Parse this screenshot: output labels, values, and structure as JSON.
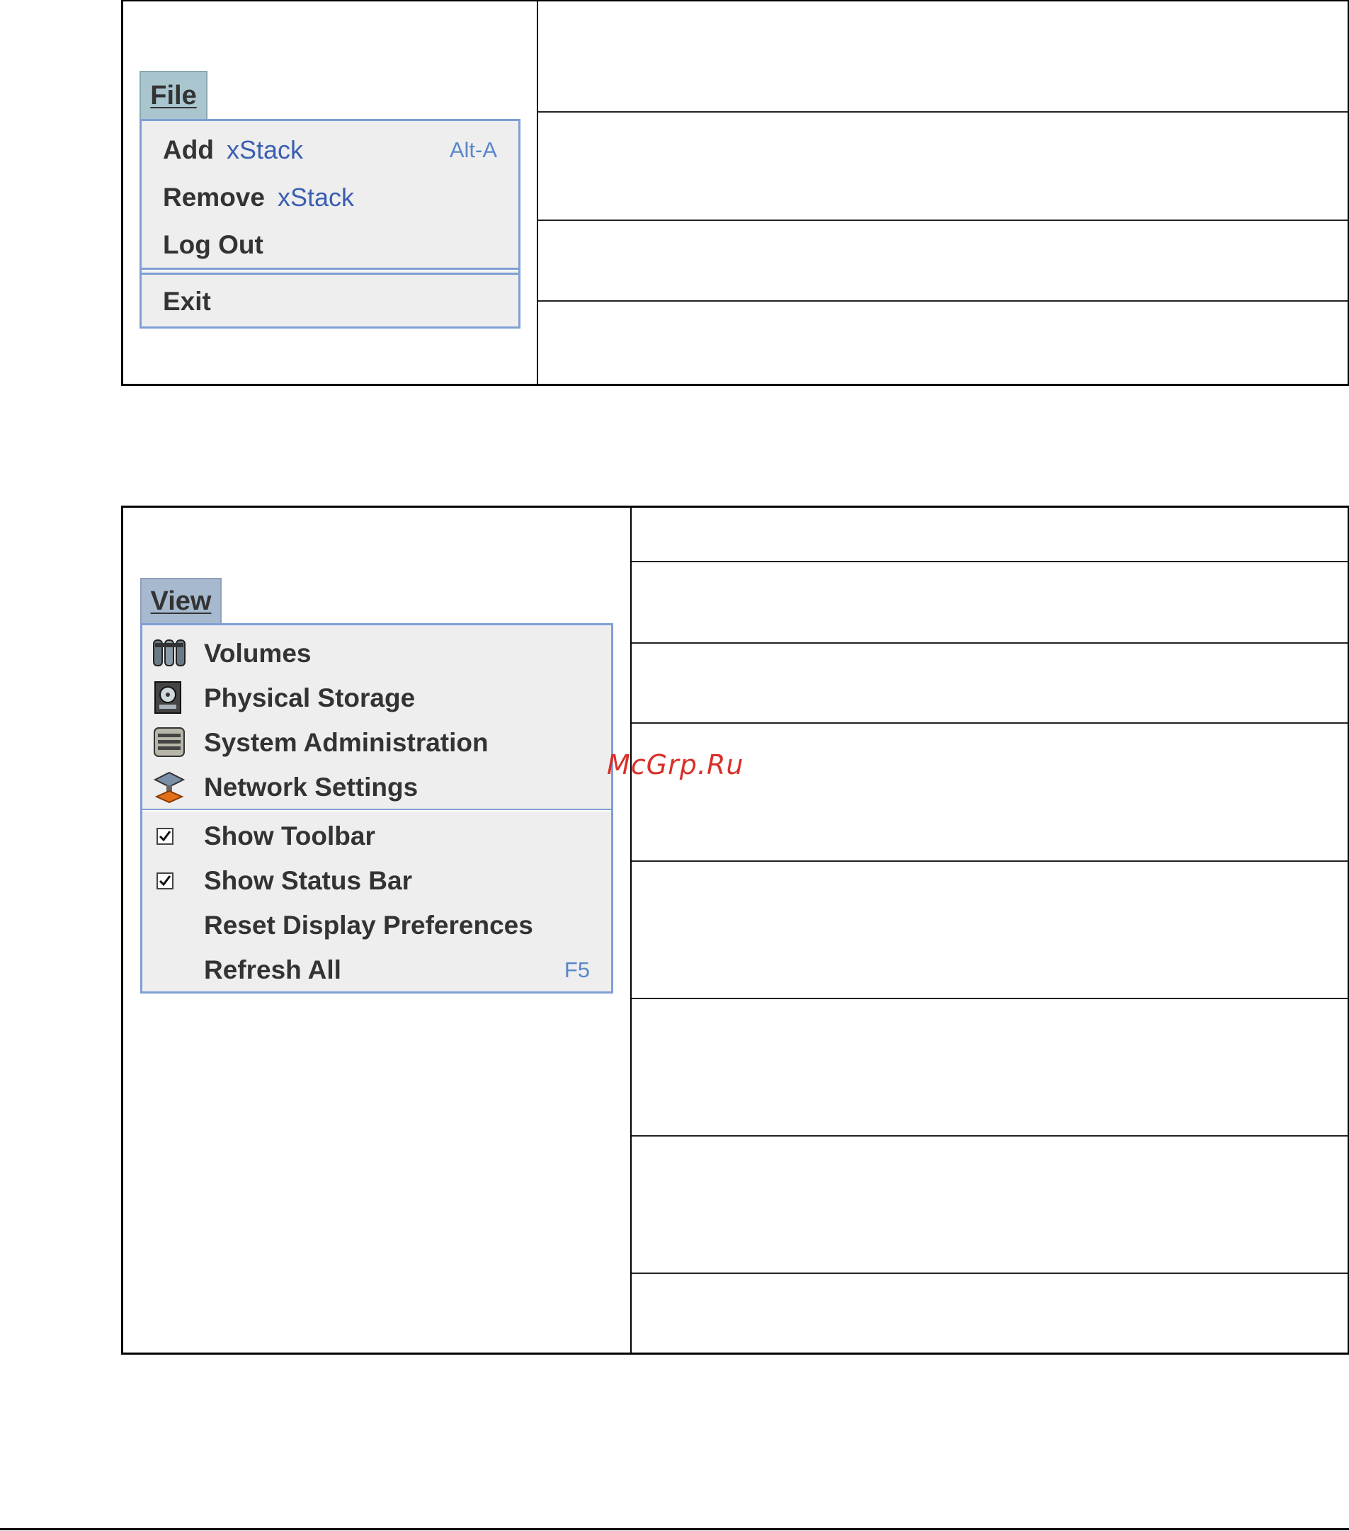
{
  "file_menu": {
    "header": "File",
    "items": [
      {
        "label": "Add",
        "sub": "xStack",
        "accel": "Alt-A"
      },
      {
        "label": "Remove",
        "sub": "xStack",
        "accel": ""
      },
      {
        "label": "Log Out",
        "sub": "",
        "accel": ""
      },
      {
        "label": "Exit",
        "sub": "",
        "accel": ""
      }
    ]
  },
  "view_menu": {
    "header": "View",
    "items": [
      {
        "label": "Volumes",
        "icon": "volumes-icon"
      },
      {
        "label": "Physical Storage",
        "icon": "hard-drive-icon"
      },
      {
        "label": "System Administration",
        "icon": "server-icon"
      },
      {
        "label": "Network Settings",
        "icon": "network-icon"
      },
      {
        "label": "Show Toolbar",
        "checked": true
      },
      {
        "label": "Show Status Bar",
        "checked": true
      },
      {
        "label": "Reset Display Preferences"
      },
      {
        "label": "Refresh All",
        "accel": "F5"
      }
    ]
  },
  "watermark": "McGrp.Ru"
}
